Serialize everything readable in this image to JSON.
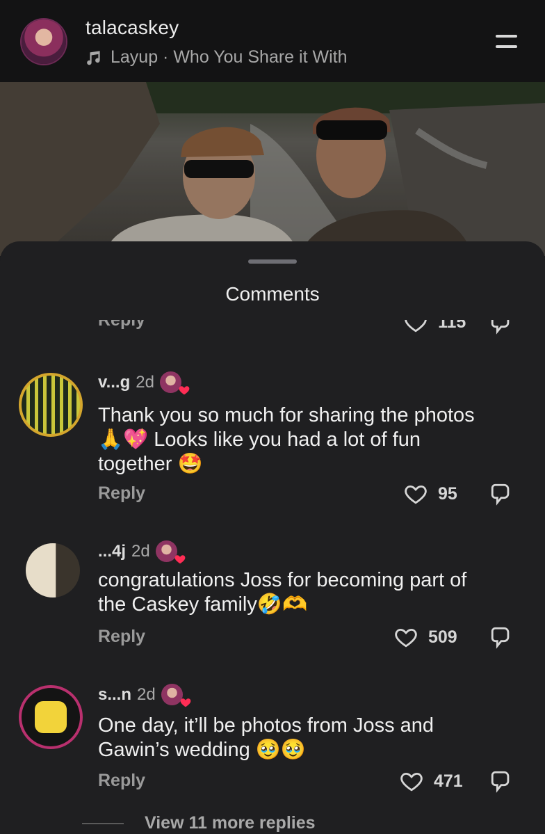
{
  "header": {
    "username": "talacaskey",
    "song": "Layup · Who You Share it With"
  },
  "sheet": {
    "title": "Comments"
  },
  "partial_comment": {
    "reply_label": "Reply",
    "likes": "115"
  },
  "comments": [
    {
      "user": "v...g",
      "time": "2d",
      "text_line1": "Thank you so much for sharing the photos",
      "text_line2": "🙏💖 Looks like you had a lot of fun",
      "text_line3": "together 🤩",
      "reply_label": "Reply",
      "likes": "95"
    },
    {
      "user": "...4j",
      "time": "2d",
      "text_line1": "congratulations Joss for becoming part of",
      "text_line2": "the Caskey family🤣🫶",
      "reply_label": "Reply",
      "likes": "509"
    },
    {
      "user": "s...n",
      "time": "2d",
      "text_line1": "One day, it’ll be photos from Joss and",
      "text_line2": "Gawin’s wedding 🥹🥹",
      "reply_label": "Reply",
      "likes": "471"
    }
  ],
  "view_more": "View 11 more replies",
  "colors": {
    "background": "#1f1f21",
    "text": "#f0f0f0",
    "muted": "#a9a9a9",
    "author_heart": "#ff2d55"
  }
}
